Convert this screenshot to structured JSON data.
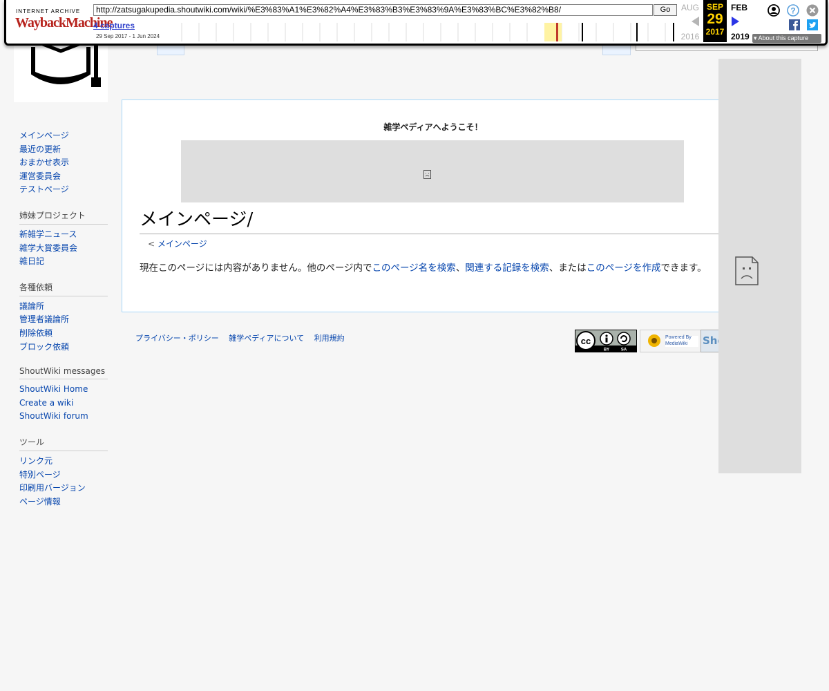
{
  "wayback": {
    "logo_top": "INTERNET ARCHIVE",
    "logo_main": "WaybackMachine",
    "url": "http://zatsugakupedia.shoutwiki.com/wiki/%E3%83%A1%E3%82%A4%E3%83%B3%E3%83%9A%E3%83%BC%E3%82%B8/",
    "go_label": "Go",
    "captures_label": "4 captures",
    "date_range": "29 Sep 2017 - 1 Jun 2024",
    "prev_month": "AUG",
    "prev_year": "2016",
    "current_month": "SEP",
    "current_day": "29",
    "current_year": "2017",
    "next_month": "FEB",
    "next_year": "2019",
    "about_label": "About this capture",
    "colors": {
      "current_bg": "#000000",
      "current_fg": "#ffd200",
      "nav_arrow": "#2b35e6"
    }
  },
  "sidebar": {
    "navigation": [
      "メインページ",
      "最近の更新",
      "おまかせ表示",
      "運営委員会",
      "テストページ"
    ],
    "sections": [
      {
        "heading": "姉妹プロジェクト",
        "items": [
          "新雑学ニュース",
          "雑学大賞委員会",
          "雑日記"
        ]
      },
      {
        "heading": "各種依頼",
        "items": [
          "議論所",
          "管理者議論所",
          "削除依頼",
          "ブロック依頼"
        ]
      },
      {
        "heading": "ShoutWiki messages",
        "items": [
          "ShoutWiki Home",
          "Create a wiki",
          "ShoutWiki forum"
        ]
      },
      {
        "heading": "ツール",
        "items": [
          "リンク元",
          "特別ページ",
          "印刷用バージョン",
          "ページ情報"
        ]
      }
    ]
  },
  "content": {
    "welcome": "雑学ペディアへようこそ！",
    "title": "メインページ/",
    "subtitle_prefix": "< ",
    "subtitle_link": "メインページ",
    "text_1": "現在このページには内容がありません。他のページ内で",
    "link_1": "このページ名を検索",
    "text_2": "、",
    "link_2": "関連する記録を検索",
    "text_3": "、または",
    "link_3": "このページを作成",
    "text_4": "できます。"
  },
  "footer": {
    "links": [
      "プライバシー・ポリシー",
      "雑学ペディアについて",
      "利用規約"
    ],
    "mediawiki_label": "Powered By MediaWiki",
    "shoutwiki_label": "Sho"
  }
}
